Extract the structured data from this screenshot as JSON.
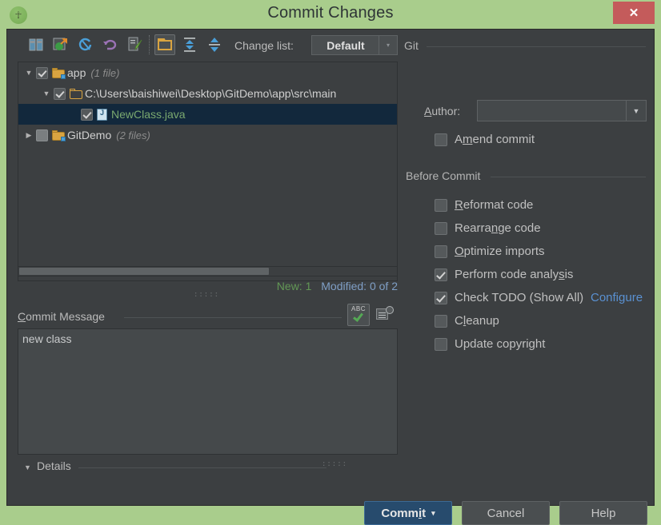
{
  "window": {
    "title": "Commit Changes",
    "app_icon": "android-studio-icon",
    "close_label": "✕",
    "titlebar_color": "#a9cd8c",
    "dialog_bg": "#3c3f41",
    "close_btn_color": "#c45b5b"
  },
  "toolbar": {
    "icons": [
      "show-diff-icon",
      "move-to-another-changelist-icon",
      "refresh-icon",
      "revert-icon",
      "edit-source-icon",
      "group-by-directory-icon",
      "expand-all-icon",
      "collapse-all-icon"
    ],
    "changelist_label": "Change list:",
    "changelist_value": "Default",
    "changelist_arrow": "▾",
    "group_label": "Git"
  },
  "tree": {
    "rows": [
      {
        "twisty": "▼",
        "checkbox": "checked",
        "icon": "module-folder-icon",
        "label": "app",
        "count": "(1 file)",
        "indent": 0,
        "selected": false,
        "label_kind": "dir"
      },
      {
        "twisty": "▼",
        "checkbox": "checked",
        "icon": "folder-icon",
        "label": "C:\\Users\\baishiwei\\Desktop\\GitDemo\\app\\src\\main",
        "count": "",
        "indent": 1,
        "selected": false,
        "label_kind": "dir"
      },
      {
        "twisty": "",
        "checkbox": "checked",
        "icon": "java-file-icon",
        "label": "NewClass.java",
        "count": "",
        "indent": 2,
        "selected": true,
        "label_kind": "file"
      },
      {
        "twisty": "▶",
        "checkbox": "unchecked",
        "icon": "module-folder-icon",
        "label": "GitDemo",
        "count": "(2 files)",
        "indent": 0,
        "selected": false,
        "label_kind": "dir"
      }
    ]
  },
  "counts": {
    "new": "New: 1",
    "modified": "Modified: 0 of 2",
    "new_color": "#629755",
    "modified_color": "#7f9fc6"
  },
  "commit_message": {
    "label_prefix": "C",
    "label_rest": "ommit Message",
    "value": "new class",
    "spellcheck_icon": "spellcheck-abc-icon",
    "spellcheck_text": "ABC",
    "history_icon": "message-history-icon"
  },
  "details": {
    "twisty": "▼",
    "label": "Details"
  },
  "git": {
    "author_label_prefix": "A",
    "author_label_rest": "uthor:",
    "author_value": "",
    "author_placeholder": "",
    "author_arrow": "▼",
    "amend": {
      "label_prefix": "A",
      "label_mnemonic": "m",
      "label_rest": "end commit",
      "checked": false
    }
  },
  "before_commit": {
    "title": "Before Commit",
    "options": [
      {
        "prefix": "",
        "mnemonic": "R",
        "rest": "eformat code",
        "checked": false,
        "name": "reformat-code"
      },
      {
        "prefix": "Rearra",
        "mnemonic": "n",
        "rest": "ge code",
        "checked": false,
        "name": "rearrange-code"
      },
      {
        "prefix": "",
        "mnemonic": "O",
        "rest": "ptimize imports",
        "checked": false,
        "name": "optimize-imports"
      },
      {
        "prefix": "Perform code analy",
        "mnemonic": "s",
        "rest": "is",
        "checked": true,
        "name": "perform-code-analysis"
      },
      {
        "prefix": "Check TODO (Show All)",
        "mnemonic": "",
        "rest": "",
        "checked": true,
        "name": "check-todo"
      },
      {
        "prefix": "C",
        "mnemonic": "l",
        "rest": "eanup",
        "checked": false,
        "name": "cleanup"
      },
      {
        "prefix": "Update copyright",
        "mnemonic": "",
        "rest": "",
        "checked": false,
        "name": "update-copyright"
      }
    ],
    "configure_link": "Configure",
    "configure_color": "#5a91d2"
  },
  "footer": {
    "commit_prefix": "Comm",
    "commit_mnemonic": "i",
    "commit_rest": "t",
    "commit_caret": "▾",
    "cancel": "Cancel",
    "help": "Help",
    "commit_color": "#274b6d"
  }
}
